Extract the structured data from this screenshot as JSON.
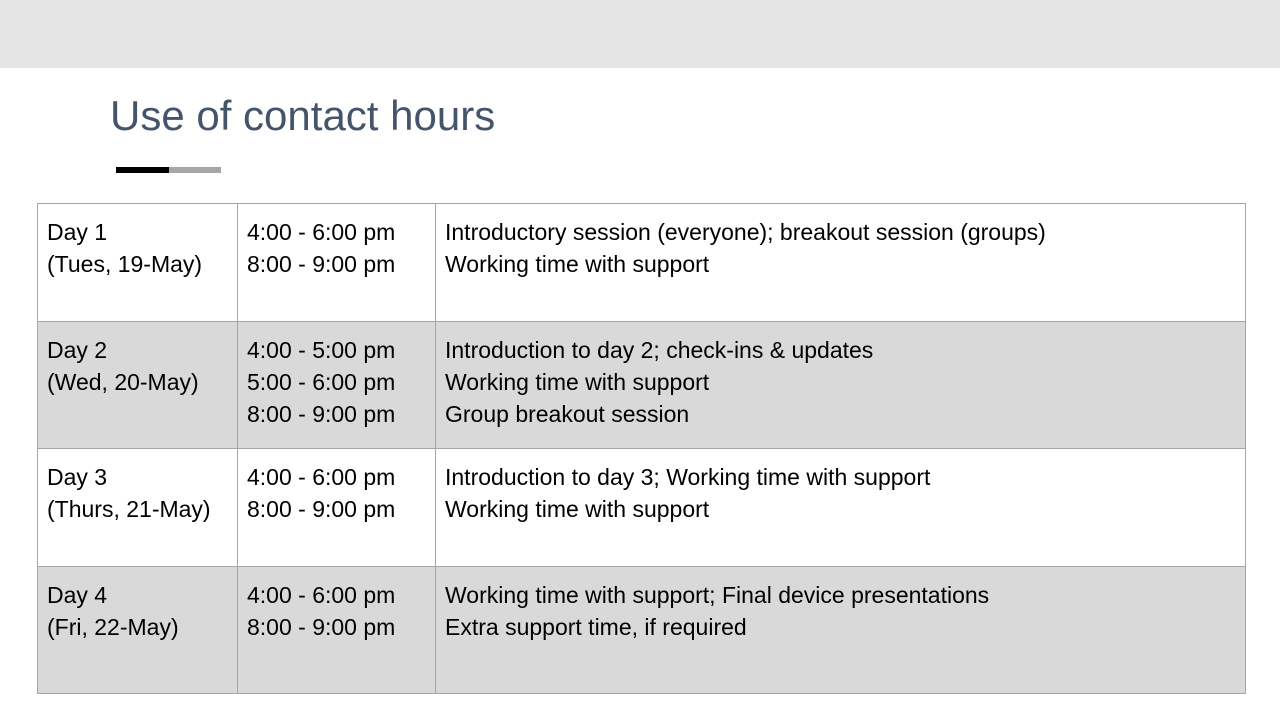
{
  "slide": {
    "title": "Use of contact hours"
  },
  "schedule": {
    "rows": [
      {
        "day": "Day 1",
        "date": "(Tues, 19-May)",
        "times": [
          "4:00 - 6:00 pm",
          "8:00 - 9:00 pm"
        ],
        "activities": [
          "Introductory session (everyone); breakout session (groups)",
          "Working time with support"
        ]
      },
      {
        "day": "Day 2",
        "date": "(Wed, 20-May)",
        "times": [
          "4:00 - 5:00 pm",
          "5:00 - 6:00 pm",
          "8:00 - 9:00 pm"
        ],
        "activities": [
          "Introduction to day 2; check-ins & updates",
          "Working time with support",
          "Group breakout session"
        ]
      },
      {
        "day": "Day 3",
        "date": "(Thurs, 21-May)",
        "times": [
          "4:00 - 6:00 pm",
          "8:00 - 9:00 pm"
        ],
        "activities": [
          "Introduction to day 3; Working time with support",
          "Working time with support"
        ]
      },
      {
        "day": "Day 4",
        "date": "(Fri, 22-May)",
        "times": [
          "4:00 - 6:00 pm",
          "8:00 - 9:00 pm"
        ],
        "activities": [
          "Working time with support; Final device presentations",
          "Extra support time, if required"
        ]
      }
    ]
  }
}
